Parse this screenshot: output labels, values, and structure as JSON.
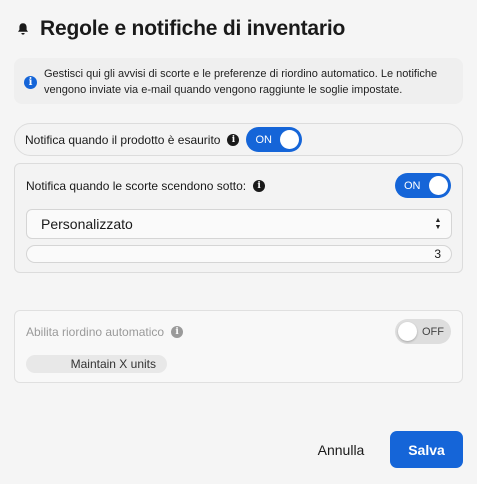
{
  "header": {
    "title": "Regole e notifiche di inventario",
    "icon": "bell-icon"
  },
  "info": {
    "text": "Gestisci qui gli avvisi di scorte e le preferenze di riordino automatico. Le notifiche vengono inviate via e-mail quando vengono raggiunte le soglie impostate.",
    "icon": "info-icon"
  },
  "out_of_stock": {
    "label": "Notifica quando il prodotto è esaurito",
    "toggle_label": "ON",
    "enabled": true
  },
  "low_stock": {
    "label": "Notifica quando le scorte scendono sotto:",
    "toggle_label": "ON",
    "enabled": true,
    "select_value": "Personalizzato",
    "threshold_value": "3"
  },
  "auto_reorder": {
    "label": "Abilita riordino automatico",
    "toggle_label": "OFF",
    "enabled": false,
    "strategy_value": "Maintain X units"
  },
  "footer": {
    "cancel_label": "Annulla",
    "save_label": "Salva"
  },
  "colors": {
    "accent": "#1565d8",
    "background": "#f5f5f5"
  }
}
